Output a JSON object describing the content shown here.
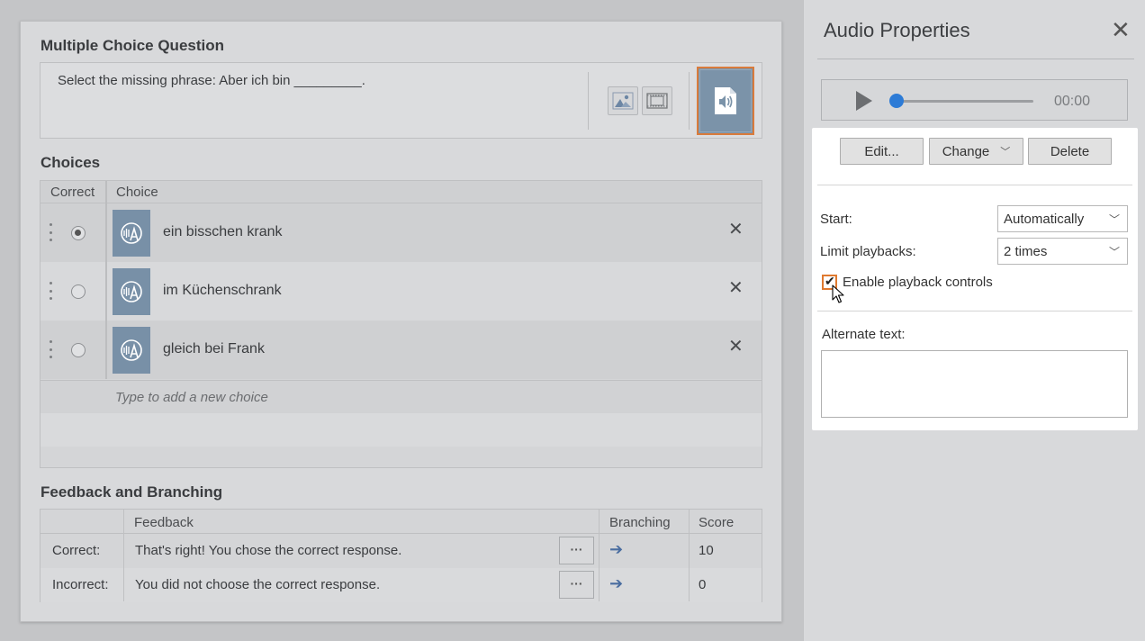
{
  "editor": {
    "question_title": "Multiple Choice Question",
    "question_text": "Select the missing phrase:  Aber ich bin _________.",
    "choices_title": "Choices",
    "choices_header": {
      "correct": "Correct",
      "choice": "Choice"
    },
    "choices": [
      {
        "text": "ein bisschen krank",
        "correct": true
      },
      {
        "text": "im Küchenschrank",
        "correct": false
      },
      {
        "text": "gleich bei Frank",
        "correct": false
      }
    ],
    "new_choice_placeholder": "Type to add a new choice",
    "feedback_title": "Feedback and Branching",
    "feedback_header": {
      "feedback": "Feedback",
      "branching": "Branching",
      "score": "Score"
    },
    "feedback_rows": [
      {
        "label": "Correct:",
        "text": "That's right! You chose the correct response.",
        "more": "···",
        "score": "10"
      },
      {
        "label": "Incorrect:",
        "text": "You did not choose the correct response.",
        "more": "···",
        "score": "0"
      }
    ],
    "delete_glyph": "✕",
    "branch_glyph": "➔"
  },
  "panel": {
    "title": "Audio Properties",
    "close_glyph": "✕",
    "player": {
      "time": "00:00",
      "progress": 0
    },
    "buttons": {
      "edit": "Edit...",
      "change": "Change",
      "delete": "Delete"
    },
    "start_label": "Start:",
    "start_value": "Automatically",
    "limit_label": "Limit playbacks:",
    "limit_value": "2 times",
    "enable_controls_label": "Enable playback controls",
    "enable_controls_checked": true,
    "alt_text_label": "Alternate text:",
    "alt_text_value": ""
  },
  "colors": {
    "accent_orange": "#e07a30",
    "audio_tile": "#7b93a9",
    "slider_knob": "#2d7bd6"
  }
}
